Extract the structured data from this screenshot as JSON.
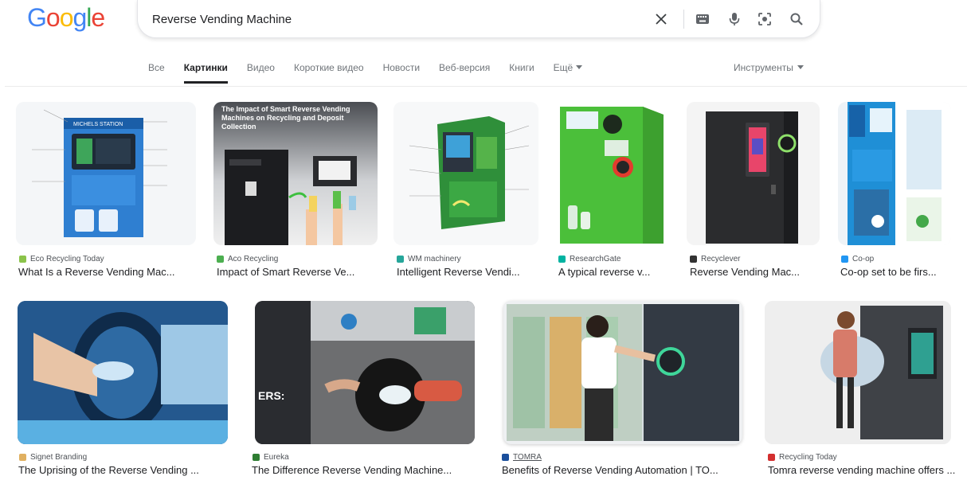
{
  "logo": {
    "text": "Google",
    "letters": [
      "G",
      "o",
      "o",
      "g",
      "l",
      "e"
    ],
    "colors": [
      "#4285f4",
      "#ea4335",
      "#fbbc05",
      "#4285f4",
      "#34a853",
      "#ea4335"
    ]
  },
  "search": {
    "query": "Reverse Vending Machine",
    "clear_icon": "close-icon",
    "keyboard_icon": "keyboard-icon",
    "voice_icon": "microphone-icon",
    "lens_icon": "lens-icon",
    "submit_icon": "search-icon"
  },
  "tabs": [
    {
      "label": "Все",
      "active": false
    },
    {
      "label": "Картинки",
      "active": true
    },
    {
      "label": "Видео",
      "active": false
    },
    {
      "label": "Короткие видео",
      "active": false
    },
    {
      "label": "Новости",
      "active": false
    },
    {
      "label": "Веб-версия",
      "active": false
    },
    {
      "label": "Книги",
      "active": false
    },
    {
      "label": "Ещё",
      "active": false
    }
  ],
  "more_tab": {
    "label": "Ещё"
  },
  "tools": {
    "label": "Инструменты"
  },
  "row1": [
    {
      "source": "Eco Recycling Today",
      "title": "What Is a Reverse Vending Mac...",
      "favicon_color": "#8bc34a",
      "thumb_label": "MICHELS STATION"
    },
    {
      "source": "Aco Recycling",
      "title": "Impact of Smart Reverse Ve...",
      "favicon_color": "#4caf50",
      "thumb_label": "The Impact of Smart Reverse Vending Machines on Recycling and Deposit Collection"
    },
    {
      "source": "WM machinery",
      "title": "Intelligent Reverse Vendi...",
      "favicon_color": "#26a69a",
      "thumb_label": ""
    },
    {
      "source": "ResearchGate",
      "title": "A typical reverse v...",
      "favicon_color": "#00b3a1",
      "thumb_label": ""
    },
    {
      "source": "Recyclever",
      "title": "Reverse Vending Mac...",
      "favicon_color": "#333333",
      "thumb_label": ""
    },
    {
      "source": "Co-op",
      "title": "Co-op set to be firs...",
      "favicon_color": "#2196f3",
      "thumb_label": ""
    }
  ],
  "row2": [
    {
      "source": "Signet Branding",
      "title": "The Uprising of the Reverse Vending ...",
      "favicon_color": "#e0b060"
    },
    {
      "source": "Eureka",
      "title": "The Difference Reverse Vending Machine...",
      "favicon_color": "#2e7d32",
      "thumb_label": "ERS:"
    },
    {
      "source": "TOMRA",
      "title": "Benefits of Reverse Vending Automation | TO...",
      "favicon_color": "#1a4f9c"
    },
    {
      "source": "Recycling Today",
      "title": "Tomra reverse vending machine offers ...",
      "favicon_color": "#d32f2f"
    }
  ]
}
